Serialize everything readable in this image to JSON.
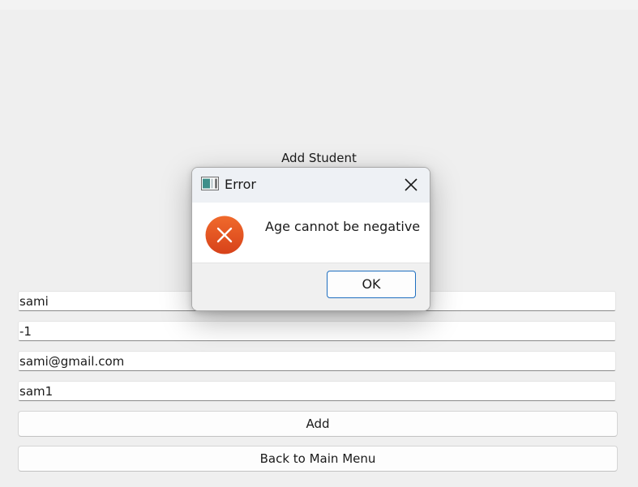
{
  "form": {
    "title": "Add Student",
    "fields": [
      {
        "name": "name",
        "value": "sami"
      },
      {
        "name": "age",
        "value": "-1"
      },
      {
        "name": "email",
        "value": "sami@gmail.com"
      },
      {
        "name": "username",
        "value": "sam1"
      }
    ],
    "add_label": "Add",
    "back_label": "Back to Main Menu"
  },
  "dialog": {
    "title": "Error",
    "message": "Age cannot be negative",
    "ok_label": "OK",
    "icon": "error-icon",
    "close_icon": "close-icon",
    "colors": {
      "error_icon": "#e2531e",
      "ok_border": "#1f6fc0"
    }
  }
}
